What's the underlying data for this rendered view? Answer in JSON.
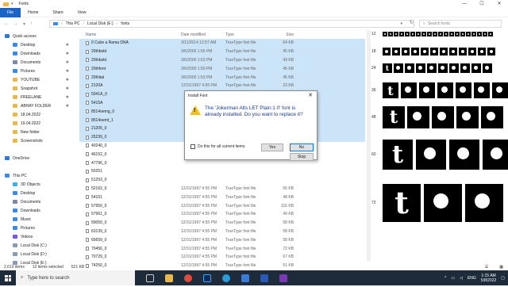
{
  "window": {
    "title": "Fonts",
    "controls": [
      "—",
      "☐",
      "✕"
    ]
  },
  "ribbon": {
    "tabs": [
      "File",
      "Home",
      "Share",
      "View"
    ]
  },
  "address": {
    "crumbs": [
      "This PC",
      "Local Disk (E:)",
      "fonts"
    ],
    "search_placeholder": "Search fonts"
  },
  "sidebar": {
    "items": [
      {
        "label": "Quick access",
        "icon": "star-icon",
        "color": "#2a7ad8",
        "pinned": false,
        "indent": 0
      },
      {
        "label": "Desktop",
        "icon": "desktop-icon",
        "color": "#3a8ae8",
        "pinned": true,
        "indent": 1
      },
      {
        "label": "Downloads",
        "icon": "download-icon",
        "color": "#3a8ae8",
        "pinned": true,
        "indent": 1
      },
      {
        "label": "Documents",
        "icon": "documents-icon",
        "color": "#7a8aa0",
        "pinned": true,
        "indent": 1
      },
      {
        "label": "Pictures",
        "icon": "pictures-icon",
        "color": "#3a8ae8",
        "pinned": true,
        "indent": 1
      },
      {
        "label": "YOUTUBE",
        "icon": "folder-icon",
        "color": "#e8b84a",
        "pinned": true,
        "indent": 1
      },
      {
        "label": "Snapshot",
        "icon": "folder-icon",
        "color": "#e8b84a",
        "pinned": true,
        "indent": 1
      },
      {
        "label": "FREELANE",
        "icon": "folder-icon",
        "color": "#e8b84a",
        "pinned": true,
        "indent": 1
      },
      {
        "label": "ABHAY FOLDER",
        "icon": "folder-icon",
        "color": "#e8b84a",
        "pinned": true,
        "indent": 1
      },
      {
        "label": "18.04.2022",
        "icon": "folder-icon",
        "color": "#e8b84a",
        "pinned": false,
        "indent": 1
      },
      {
        "label": "19.04.2022",
        "icon": "folder-icon",
        "color": "#e8b84a",
        "pinned": false,
        "indent": 1
      },
      {
        "label": "New folder",
        "icon": "folder-icon",
        "color": "#e8b84a",
        "pinned": false,
        "indent": 1
      },
      {
        "label": "Screenshots",
        "icon": "folder-icon",
        "color": "#e8b84a",
        "pinned": false,
        "indent": 1
      },
      {
        "label": "",
        "icon": "",
        "color": "#ffffff",
        "pinned": false,
        "indent": 0
      },
      {
        "label": "OneDrive",
        "icon": "cloud-icon",
        "color": "#2a7ad8",
        "pinned": false,
        "indent": 0
      },
      {
        "label": "",
        "icon": "",
        "color": "#ffffff",
        "pinned": false,
        "indent": 0
      },
      {
        "label": "This PC",
        "icon": "computer-icon",
        "color": "#3a8ae8",
        "pinned": false,
        "indent": 0
      },
      {
        "label": "3D Objects",
        "icon": "3d-objects-icon",
        "color": "#3ab0e8",
        "pinned": false,
        "indent": 1
      },
      {
        "label": "Desktop",
        "icon": "desktop-icon",
        "color": "#3a8ae8",
        "pinned": false,
        "indent": 1
      },
      {
        "label": "Documents",
        "icon": "documents-icon",
        "color": "#7a8aa0",
        "pinned": false,
        "indent": 1
      },
      {
        "label": "Downloads",
        "icon": "download-icon",
        "color": "#3a8ae8",
        "pinned": false,
        "indent": 1
      },
      {
        "label": "Music",
        "icon": "music-icon",
        "color": "#3a8ae8",
        "pinned": false,
        "indent": 1
      },
      {
        "label": "Pictures",
        "icon": "pictures-icon",
        "color": "#3a8ae8",
        "pinned": false,
        "indent": 1
      },
      {
        "label": "Videos",
        "icon": "videos-icon",
        "color": "#7a5ad8",
        "pinned": false,
        "indent": 1
      },
      {
        "label": "Local Disk (C:)",
        "icon": "disk-icon",
        "color": "#8a9ab0",
        "pinned": false,
        "indent": 1
      },
      {
        "label": "Local Disk (D:)",
        "icon": "disk-icon",
        "color": "#8a9ab0",
        "pinned": false,
        "indent": 1
      },
      {
        "label": "Local Disk (E:)",
        "icon": "disk-icon",
        "color": "#8a9ab0",
        "pinned": false,
        "indent": 1
      }
    ]
  },
  "filelist": {
    "headers": [
      "Name",
      "Date modified",
      "Type",
      "Size"
    ],
    "rows": [
      {
        "name": "0 Cube a Rama DNA",
        "date": "3/11/2014 12:57 AM",
        "type": "TrueType font file",
        "size": "64 KB",
        "sel": true
      },
      {
        "name": "20thbold",
        "date": "3/6/2000 1:56 PM",
        "type": "TrueType font file",
        "size": "45 KB",
        "sel": true
      },
      {
        "name": "20thbold",
        "date": "3/6/2000 1:53 PM",
        "type": "TrueType font file",
        "size": "43 KB",
        "sel": true
      },
      {
        "name": "20thfont",
        "date": "3/6/2000 1:50 PM",
        "type": "TrueType font file",
        "size": "45 KB",
        "sel": true
      },
      {
        "name": "20thital",
        "date": "3/6/2000 1:53 PM",
        "type": "TrueType font file",
        "size": "45 KB",
        "sel": true
      },
      {
        "name": "2120A",
        "date": "12/31/1997 4:55 PM",
        "type": "TrueType font file",
        "size": "23 KB",
        "sel": true
      },
      {
        "name": "5041A_0",
        "date": "",
        "type": "",
        "size": "",
        "sel": true
      },
      {
        "name": "5415A",
        "date": "",
        "type": "",
        "size": "",
        "sel": true
      },
      {
        "name": "8514oemg_0",
        "date": "",
        "type": "",
        "size": "",
        "sel": true
      },
      {
        "name": "8514oemt_1",
        "date": "",
        "type": "",
        "size": "",
        "sel": true
      },
      {
        "name": "21205_0",
        "date": "",
        "type": "",
        "size": "",
        "sel": true
      },
      {
        "name": "25239_0",
        "date": "",
        "type": "",
        "size": "",
        "sel": true
      },
      {
        "name": "40240_0",
        "date": "",
        "type": "",
        "size": "",
        "sel": false
      },
      {
        "name": "46152_0",
        "date": "",
        "type": "",
        "size": "",
        "sel": false
      },
      {
        "name": "47796_0",
        "date": "",
        "type": "",
        "size": "",
        "sel": false
      },
      {
        "name": "50251",
        "date": "",
        "type": "",
        "size": "",
        "sel": false
      },
      {
        "name": "51253_0",
        "date": "",
        "type": "",
        "size": "",
        "sel": false
      },
      {
        "name": "52162_0",
        "date": "12/31/1997 4:55 PM",
        "type": "TrueType font file",
        "size": "56 KB",
        "sel": false
      },
      {
        "name": "54151",
        "date": "12/31/1997 4:55 PM",
        "type": "TrueType font file",
        "size": "48 KB",
        "sel": false
      },
      {
        "name": "57950_0",
        "date": "12/31/1997 4:55 PM",
        "type": "TrueType font file",
        "size": "116 KB",
        "sel": false
      },
      {
        "name": "57961_0",
        "date": "12/31/1997 4:55 PM",
        "type": "TrueType font file",
        "size": "49 KB",
        "sel": false
      },
      {
        "name": "59050_0",
        "date": "12/31/1997 4:55 PM",
        "type": "TrueType font file",
        "size": "58 KB",
        "sel": false
      },
      {
        "name": "63139_0",
        "date": "12/31/1997 4:55 PM",
        "type": "TrueType font file",
        "size": "58 KB",
        "sel": false
      },
      {
        "name": "65659_0",
        "date": "12/31/1997 4:55 PM",
        "type": "TrueType font file",
        "size": "58 KB",
        "sel": false
      },
      {
        "name": "70456_0",
        "date": "12/31/1997 4:55 PM",
        "type": "TrueType font file",
        "size": "72 KB",
        "sel": false
      },
      {
        "name": "70729_0",
        "date": "12/31/1997 4:55 PM",
        "type": "TrueType font file",
        "size": "67 KB",
        "sel": false
      },
      {
        "name": "74250_0",
        "date": "12/31/1997 4:55 PM",
        "type": "TrueType font file",
        "size": "51 KB",
        "sel": false
      },
      {
        "name": "75749_0",
        "date": "12/31/1997 4:55 PM",
        "type": "TrueType font file",
        "size": "49 KB",
        "sel": false
      },
      {
        "name": "78640_0",
        "date": "12/31/1997 4:55 PM",
        "type": "TrueType font file",
        "size": "60 KB",
        "sel": false
      }
    ]
  },
  "preview": {
    "sizes": [
      "12",
      "18",
      "24",
      "36",
      "48",
      "60",
      "72"
    ]
  },
  "dialog": {
    "title": "Install Font",
    "message": "The 'Jokerman Alts LET Plain:1.0' font is already installed. Do you want to replace it?",
    "checkbox_label": "Do this for all current items",
    "yes": "Yes",
    "no": "No",
    "stop": "Stop"
  },
  "status": {
    "count": "2,610 items",
    "selected": "12 items selected",
    "size": "521 KB"
  },
  "taskbar": {
    "search_placeholder": "Type here to search",
    "lang": "ENG",
    "time": "1:15 AM",
    "date": "5/8/2022"
  },
  "colors": {
    "accent": "#1a64c8",
    "selection": "#cce4f7",
    "taskbar": "#1d2b3a"
  }
}
